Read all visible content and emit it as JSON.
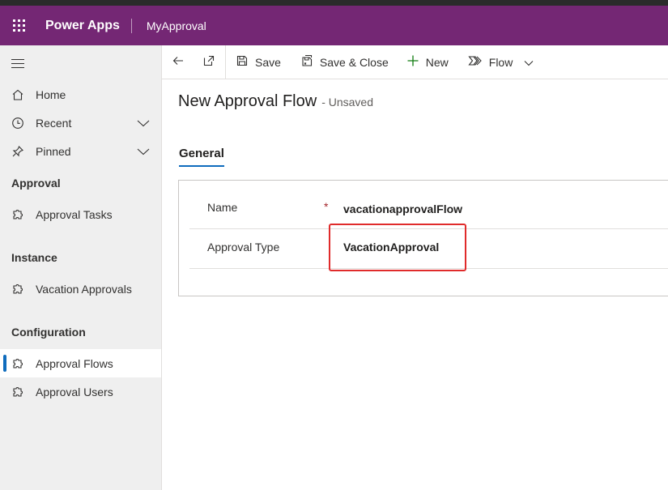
{
  "app": {
    "product_name": "Power Apps",
    "app_title": "MyApproval",
    "brand_color": "#742774"
  },
  "sidebar": {
    "menu_icon": "hamburger-icon",
    "items_top": [
      {
        "label": "Home",
        "icon": "home-icon"
      },
      {
        "label": "Recent",
        "icon": "clock-icon",
        "expandable": true
      },
      {
        "label": "Pinned",
        "icon": "pin-icon",
        "expandable": true
      }
    ],
    "groups": [
      {
        "title": "Approval",
        "items": [
          {
            "label": "Approval Tasks",
            "icon": "puzzle-icon"
          }
        ]
      },
      {
        "title": "Instance",
        "items": [
          {
            "label": "Vacation Approvals",
            "icon": "puzzle-icon"
          }
        ]
      },
      {
        "title": "Configuration",
        "items": [
          {
            "label": "Approval Flows",
            "icon": "puzzle-icon",
            "selected": true
          },
          {
            "label": "Approval Users",
            "icon": "puzzle-icon"
          }
        ]
      }
    ]
  },
  "commandbar": {
    "save": "Save",
    "save_close": "Save & Close",
    "new": "New",
    "flow": "Flow"
  },
  "form": {
    "title": "New Approval Flow",
    "status": "- Unsaved",
    "tabs": [
      "General"
    ],
    "fields": [
      {
        "label": "Name",
        "required_marker": "*",
        "value": "vacationapprovalFlow"
      },
      {
        "label": "Approval Type",
        "value": "VacationApproval"
      }
    ]
  },
  "colors": {
    "accent": "#0f6cbd",
    "required": "#a4262c",
    "highlight_box": "#e02b2b"
  }
}
